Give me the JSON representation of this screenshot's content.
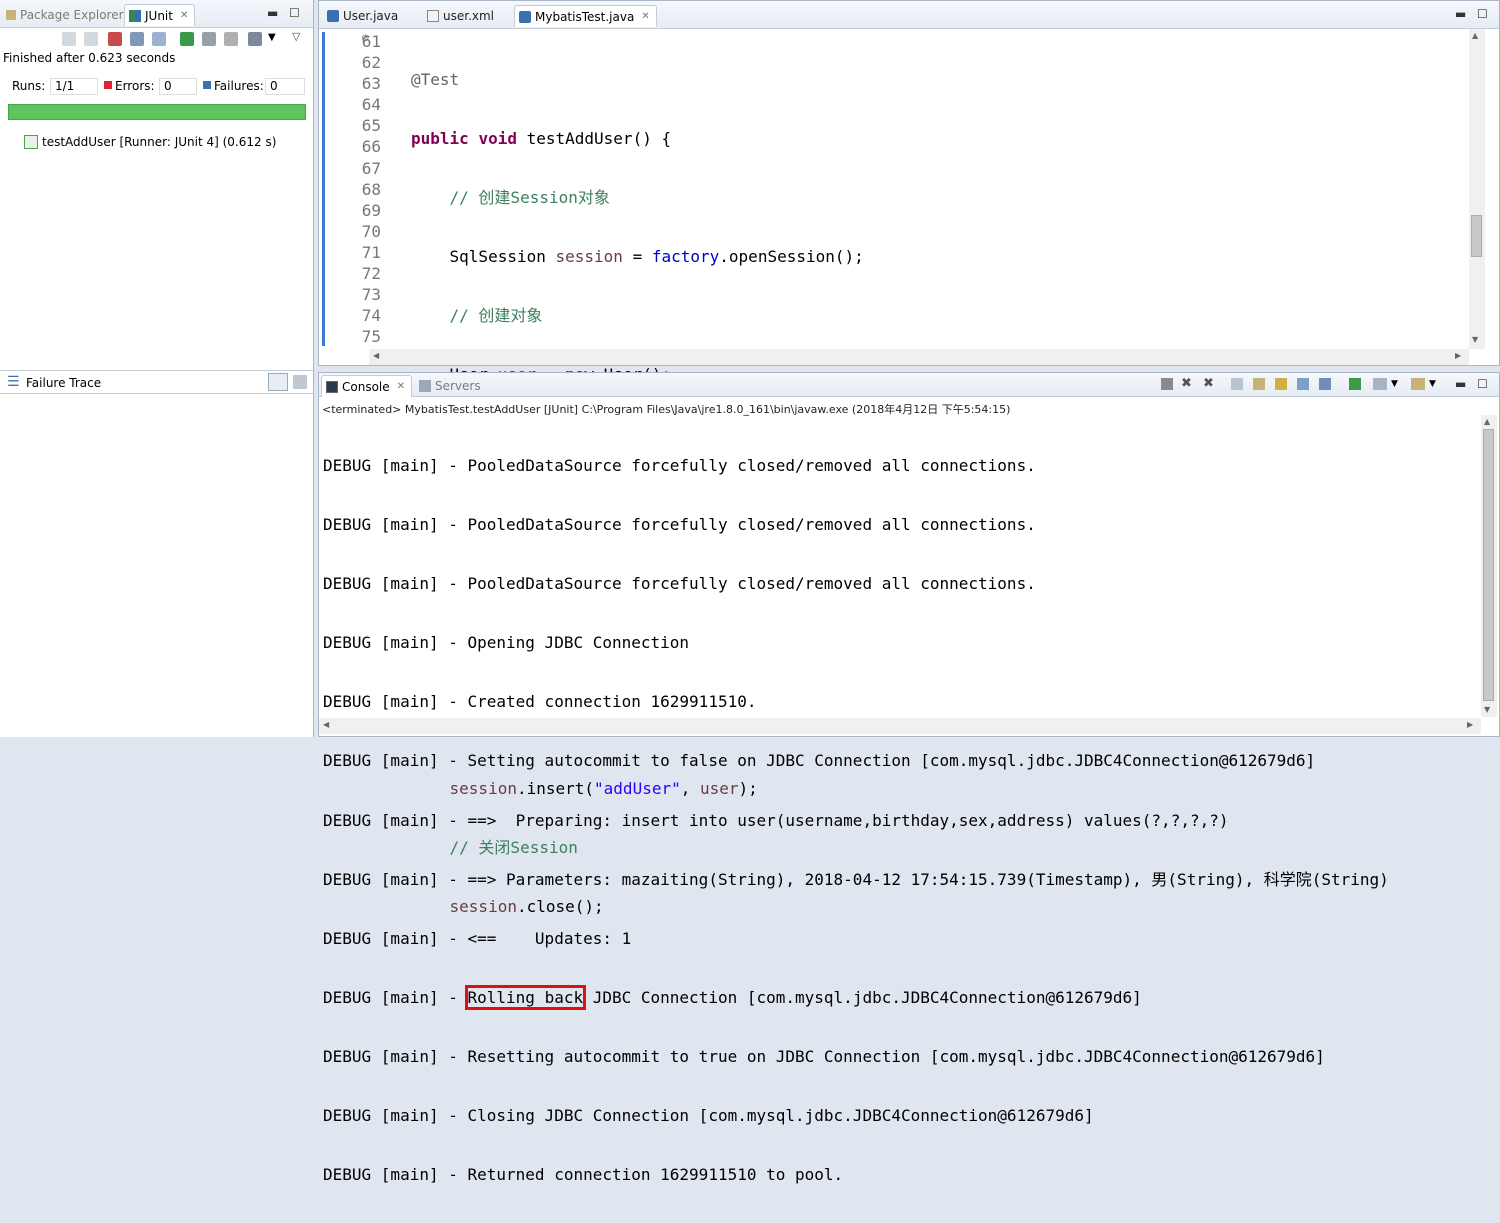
{
  "left_tabs": {
    "package_explorer": "Package Explorer",
    "junit": "JUnit"
  },
  "junit": {
    "finished": "Finished after 0.623 seconds",
    "runs_label": "Runs:",
    "runs_value": "1/1",
    "errors_label": "Errors:",
    "errors_value": "0",
    "failures_label": "Failures:",
    "failures_value": "0",
    "test_item": "testAddUser [Runner: JUnit 4] (0.612 s)",
    "failure_trace": "Failure Trace",
    "bar_color": "#5ec45e"
  },
  "editor": {
    "tabs": [
      "User.java",
      "user.xml",
      "MybatisTest.java"
    ],
    "line_numbers": [
      "61",
      "62",
      "63",
      "64",
      "65",
      "66",
      "67",
      "68",
      "69",
      "70",
      "71",
      "72",
      "73",
      "74",
      "75"
    ]
  },
  "console": {
    "tabs": {
      "console": "Console",
      "servers": "Servers"
    },
    "status": "<terminated> MybatisTest.testAddUser [JUnit] C:\\Program Files\\Java\\jre1.8.0_161\\bin\\javaw.exe (2018年4月12日 下午5:54:15)",
    "lines": [
      "DEBUG [main] - PooledDataSource forcefully closed/removed all connections.",
      "DEBUG [main] - PooledDataSource forcefully closed/removed all connections.",
      "DEBUG [main] - PooledDataSource forcefully closed/removed all connections.",
      "DEBUG [main] - Opening JDBC Connection",
      "DEBUG [main] - Created connection 1629911510.",
      "DEBUG [main] - Setting autocommit to false on JDBC Connection [com.mysql.jdbc.JDBC4Connection@612679d6]",
      "DEBUG [main] - ==>  Preparing: insert into user(username,birthday,sex,address) values(?,?,?,?)",
      "DEBUG [main] - ==> Parameters: mazaiting(String), 2018-04-12 17:54:15.739(Timestamp), 男(String), 科学院(String)",
      "DEBUG [main] - <==    Updates: 1"
    ],
    "rollback_prefix": "DEBUG [main] - ",
    "rollback_highlight": "Rolling back",
    "rollback_suffix": " JDBC Connection [com.mysql.jdbc.JDBC4Connection@612679d6]",
    "tail_lines": [
      "DEBUG [main] - Resetting autocommit to true on JDBC Connection [com.mysql.jdbc.JDBC4Connection@612679d6]",
      "DEBUG [main] - Closing JDBC Connection [com.mysql.jdbc.JDBC4Connection@612679d6]",
      "DEBUG [main] - Returned connection 1629911510 to pool."
    ],
    "highlight_color": "#e01010"
  }
}
